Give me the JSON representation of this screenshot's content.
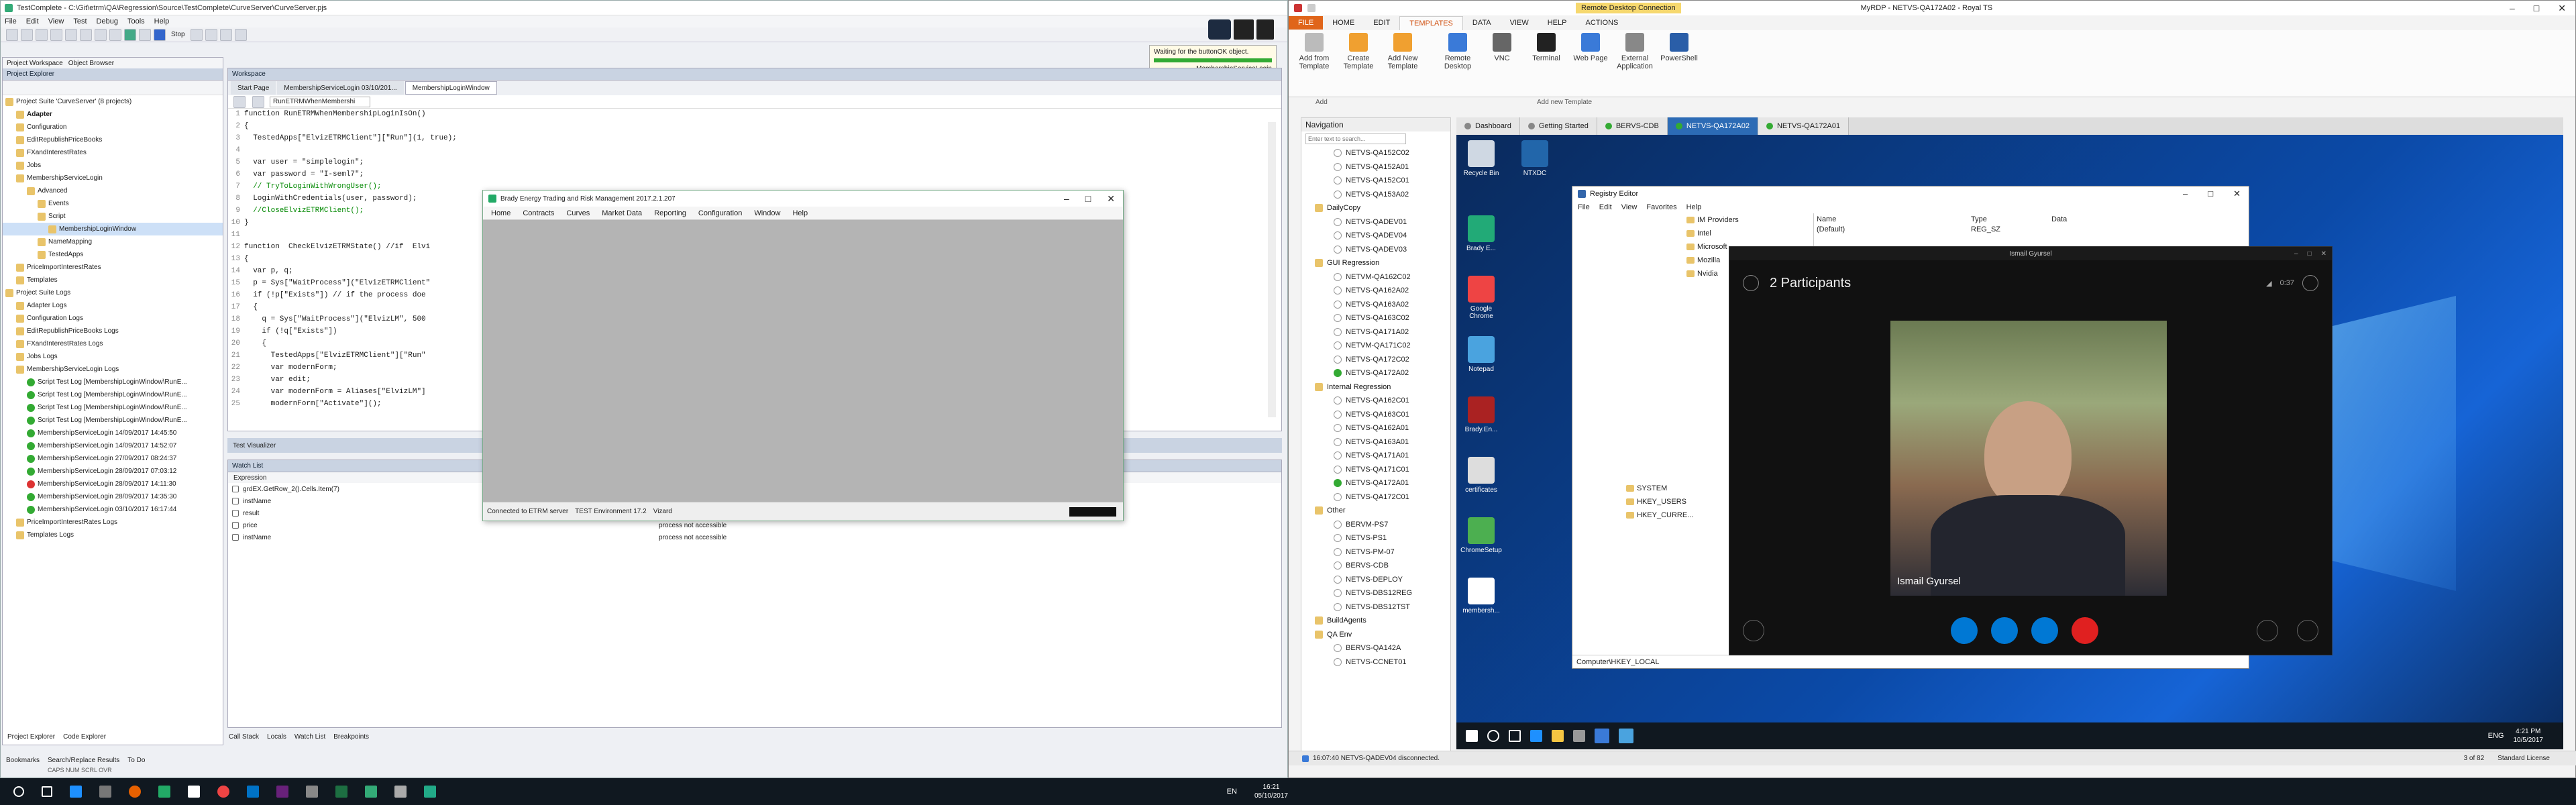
{
  "tc": {
    "title": "TestComplete - C:\\Git\\etrm\\QA\\Regression\\Source\\TestComplete\\CurveServer\\CurveServer.pjs",
    "menu": [
      "File",
      "Edit",
      "View",
      "Test",
      "Debug",
      "Tools",
      "Help"
    ],
    "waiting_tooltip": "Waiting for the buttonOK object.",
    "waiting_sub": "MembershipServiceLogin",
    "explorer_tabs": [
      "Project Workspace",
      "Object Browser"
    ],
    "explorer_title": "Project Explorer",
    "tree": [
      {
        "label": "Project Suite 'CurveServer' (8 projects)",
        "indent": 0
      },
      {
        "label": "Adapter",
        "indent": 1,
        "bold": true
      },
      {
        "label": "Configuration",
        "indent": 1
      },
      {
        "label": "EditRepublishPriceBooks",
        "indent": 1
      },
      {
        "label": "FXandInterestRates",
        "indent": 1
      },
      {
        "label": "Jobs",
        "indent": 1
      },
      {
        "label": "MembershipServiceLogin",
        "indent": 1
      },
      {
        "label": "Advanced",
        "indent": 2
      },
      {
        "label": "Events",
        "indent": 3
      },
      {
        "label": "Script",
        "indent": 3
      },
      {
        "label": "MembershipLoginWindow",
        "indent": 4,
        "selected": true
      },
      {
        "label": "NameMapping",
        "indent": 3
      },
      {
        "label": "TestedApps",
        "indent": 3
      },
      {
        "label": "PriceImportInterestRates",
        "indent": 1
      },
      {
        "label": "Templates",
        "indent": 1
      },
      {
        "label": "Project Suite Logs",
        "indent": 0
      },
      {
        "label": "Adapter Logs",
        "indent": 1
      },
      {
        "label": "Configuration Logs",
        "indent": 1
      },
      {
        "label": "EditRepublishPriceBooks Logs",
        "indent": 1
      },
      {
        "label": "FXandInterestRates Logs",
        "indent": 1
      },
      {
        "label": "Jobs Logs",
        "indent": 1
      },
      {
        "label": "MembershipServiceLogin Logs",
        "indent": 1
      },
      {
        "label": "Script Test Log [MembershipLoginWindow\\RunE...",
        "indent": 2,
        "status": "ok"
      },
      {
        "label": "Script Test Log [MembershipLoginWindow\\RunE...",
        "indent": 2,
        "status": "ok"
      },
      {
        "label": "Script Test Log [MembershipLoginWindow\\RunE...",
        "indent": 2,
        "status": "ok"
      },
      {
        "label": "Script Test Log [MembershipLoginWindow\\RunE...",
        "indent": 2,
        "status": "ok"
      },
      {
        "label": "MembershipServiceLogin 14/09/2017 14:45:50",
        "indent": 2,
        "status": "ok"
      },
      {
        "label": "MembershipServiceLogin 14/09/2017 14:52:07",
        "indent": 2,
        "status": "ok"
      },
      {
        "label": "MembershipServiceLogin 27/09/2017 08:24:37",
        "indent": 2,
        "status": "ok"
      },
      {
        "label": "MembershipServiceLogin 28/09/2017 07:03:12",
        "indent": 2,
        "status": "ok"
      },
      {
        "label": "MembershipServiceLogin 28/09/2017 14:11:30",
        "indent": 2,
        "status": "err"
      },
      {
        "label": "MembershipServiceLogin 28/09/2017 14:35:30",
        "indent": 2,
        "status": "ok"
      },
      {
        "label": "MembershipServiceLogin 03/10/2017 16:17:44",
        "indent": 2,
        "status": "ok"
      },
      {
        "label": "PriceImportInterestRates Logs",
        "indent": 1
      },
      {
        "label": "Templates Logs",
        "indent": 1
      }
    ],
    "bottom_tabs_left": [
      "Project Explorer",
      "Code Explorer"
    ],
    "status_tabs": [
      "Bookmarks",
      "Search/Replace Results",
      "To Do"
    ],
    "status_caps": "CAPS  NUM  SCRL  OVR",
    "workspace_title": "Workspace",
    "doc_tabs": [
      "Start Page",
      "MembershipServiceLogin 03/10/201...",
      "MembershipLoginWindow"
    ],
    "routine_select": "RunETRMWhenMembershi",
    "code": [
      {
        "n": "1",
        "t": "function RunETRMWhenMembershipLoginIsOn()"
      },
      {
        "n": "2",
        "t": "{"
      },
      {
        "n": "3",
        "t": "  TestedApps[\"ElvizETRMClient\"][\"Run\"](1, true);"
      },
      {
        "n": "4",
        "t": ""
      },
      {
        "n": "5",
        "t": "  var user = \"simplelogin\";"
      },
      {
        "n": "6",
        "t": "  var password = \"I-seml7\";"
      },
      {
        "n": "7",
        "t": "  // TryToLoginWithWrongUser();"
      },
      {
        "n": "8",
        "t": "  LoginWithCredentials(user, password);"
      },
      {
        "n": "9",
        "t": "  //CloseElvizETRMClient();"
      },
      {
        "n": "10",
        "t": "}"
      },
      {
        "n": "11",
        "t": ""
      },
      {
        "n": "12",
        "t": "function  CheckElvizETRMState() //if  Elvi"
      },
      {
        "n": "13",
        "t": "{"
      },
      {
        "n": "14",
        "t": "  var p, q;"
      },
      {
        "n": "15",
        "t": "  p = Sys[\"WaitProcess\"](\"ElvizETRMClient\""
      },
      {
        "n": "16",
        "t": "  if (!p[\"Exists\"]) // if the process doe"
      },
      {
        "n": "17",
        "t": "  {"
      },
      {
        "n": "18",
        "t": "    q = Sys[\"WaitProcess\"](\"ElvizLM\", 500"
      },
      {
        "n": "19",
        "t": "    if (!q[\"Exists\"])"
      },
      {
        "n": "20",
        "t": "    {"
      },
      {
        "n": "21",
        "t": "      TestedApps[\"ElvizETRMClient\"][\"Run\""
      },
      {
        "n": "22",
        "t": "      var modernForm;"
      },
      {
        "n": "23",
        "t": "      var edit;"
      },
      {
        "n": "24",
        "t": "      var modernForm = Aliases[\"ElvizLM\"]"
      },
      {
        "n": "25",
        "t": "      modernForm[\"Activate\"]();"
      }
    ],
    "visualizer_title": "Test Visualizer",
    "watch_title": "Watch List",
    "watch_header": "Expression",
    "watch": [
      {
        "expr": "grdEX.GetRow_2().Cells.Item(7)",
        "val": ""
      },
      {
        "expr": "instName",
        "val": ""
      },
      {
        "expr": "result",
        "val": "process not accessible"
      },
      {
        "expr": "price",
        "val": "process not accessible"
      },
      {
        "expr": "instName",
        "val": "process not accessible"
      }
    ],
    "bottom_tabs": [
      "Call Stack",
      "Locals",
      "Watch List",
      "Breakpoints"
    ]
  },
  "brady": {
    "title": "Brady Energy Trading and Risk Management 2017.2.1.207",
    "menu": [
      "Home",
      "Contracts",
      "Curves",
      "Market Data",
      "Reporting",
      "Configuration",
      "Window",
      "Help"
    ],
    "status": [
      "Connected to ETRM server",
      "TEST Environment 17.2",
      "Vizard"
    ]
  },
  "rts": {
    "title": "MyRDP - NETVS-QA172A02 - Royal TS",
    "context_tab": "Remote Desktop Connection",
    "ribbon_tabs": [
      "FILE",
      "HOME",
      "EDIT",
      "TEMPLATES",
      "DATA",
      "VIEW",
      "HELP",
      "ACTIONS"
    ],
    "ribbon_buttons": [
      "Add from Template",
      "Create Template",
      "Add New Template",
      "Remote Desktop",
      "VNC",
      "Terminal",
      "Web Page",
      "External Application",
      "PowerShell"
    ],
    "group_labels": [
      "Add",
      "Add new Template"
    ],
    "nav_title": "Navigation",
    "nav_search": "Enter text to search...",
    "nav": [
      {
        "type": "item",
        "label": "NETVS-QA152C02"
      },
      {
        "type": "item",
        "label": "NETVS-QA152A01"
      },
      {
        "type": "item",
        "label": "NETVS-QA152C01"
      },
      {
        "type": "item",
        "label": "NETVS-QA153A02"
      },
      {
        "type": "group",
        "label": "DailyCopy"
      },
      {
        "type": "item",
        "label": "NETVS-QADEV01"
      },
      {
        "type": "item",
        "label": "NETVS-QADEV04"
      },
      {
        "type": "item",
        "label": "NETVS-QADEV03"
      },
      {
        "type": "group",
        "label": "GUI Regression"
      },
      {
        "type": "item",
        "label": "NETVM-QA162C02"
      },
      {
        "type": "item",
        "label": "NETVS-QA162A02"
      },
      {
        "type": "item",
        "label": "NETVS-QA163A02"
      },
      {
        "type": "item",
        "label": "NETVS-QA163C02"
      },
      {
        "type": "item",
        "label": "NETVS-QA171A02"
      },
      {
        "type": "item",
        "label": "NETVM-QA171C02"
      },
      {
        "type": "item",
        "label": "NETVS-QA172C02"
      },
      {
        "type": "item",
        "label": "NETVS-QA172A02",
        "active": true
      },
      {
        "type": "group",
        "label": "Internal Regression"
      },
      {
        "type": "item",
        "label": "NETVS-QA162C01"
      },
      {
        "type": "item",
        "label": "NETVS-QA163C01"
      },
      {
        "type": "item",
        "label": "NETVS-QA162A01"
      },
      {
        "type": "item",
        "label": "NETVS-QA163A01"
      },
      {
        "type": "item",
        "label": "NETVS-QA171A01"
      },
      {
        "type": "item",
        "label": "NETVS-QA171C01"
      },
      {
        "type": "item",
        "label": "NETVS-QA172A01",
        "active": true
      },
      {
        "type": "item",
        "label": "NETVS-QA172C01"
      },
      {
        "type": "group",
        "label": "Other"
      },
      {
        "type": "item",
        "label": "BERVM-PS7"
      },
      {
        "type": "item",
        "label": "NETVS-PS1"
      },
      {
        "type": "item",
        "label": "NETVS-PM-07"
      },
      {
        "type": "item",
        "label": "BERVS-CDB"
      },
      {
        "type": "item",
        "label": "NETVS-DEPLOY"
      },
      {
        "type": "item",
        "label": "NETVS-DBS12REG"
      },
      {
        "type": "item",
        "label": "NETVS-DBS12TST"
      },
      {
        "type": "group",
        "label": "BuildAgents"
      },
      {
        "type": "group",
        "label": "QA Env"
      },
      {
        "type": "item",
        "label": "BERVS-QA142A"
      },
      {
        "type": "item",
        "label": "NETVS-CCNET01"
      }
    ],
    "session_tabs": [
      "Dashboard",
      "Getting Started",
      "BERVS-CDB",
      "NETVS-QA172A02",
      "NETVS-QA172A01"
    ],
    "status": "16:07:40 NETVS-QADEV04 disconnected.",
    "status_right": [
      "3 of 82",
      "Standard License"
    ],
    "desktop_icons": [
      "Recycle Bin",
      "NTXDC",
      "Brady E...",
      "Google Chrome",
      "Notepad",
      "Brady.En...",
      "certificates",
      "ChromeSetup",
      "membersh..."
    ],
    "regedit": {
      "title": "Registry Editor",
      "menu": [
        "File",
        "Edit",
        "View",
        "Favorites",
        "Help"
      ],
      "cols": [
        "Name",
        "Type",
        "Data"
      ],
      "tree": [
        "IM Providers",
        "Intel",
        "Microsoft",
        "Mozilla",
        "Nvidia",
        "SYSTEM",
        "HKEY_USERS",
        "HKEY_CURRE..."
      ],
      "row": [
        "(Default)",
        "REG_SZ",
        ""
      ],
      "path": "Computer\\HKEY_LOCAL"
    },
    "skype": {
      "caller": "Ismail Gyursel",
      "participants": "2 Participants",
      "timer": "0:37",
      "name_overlay": "Ismail Gyursel"
    },
    "remote_clock": [
      "4:21 PM",
      "10/5/2017"
    ],
    "remote_lang": "ENG",
    "remote_notif": "Standard License"
  },
  "host_taskbar": {
    "lang": "EN",
    "time": "16:21",
    "date": "05/10/2017"
  }
}
